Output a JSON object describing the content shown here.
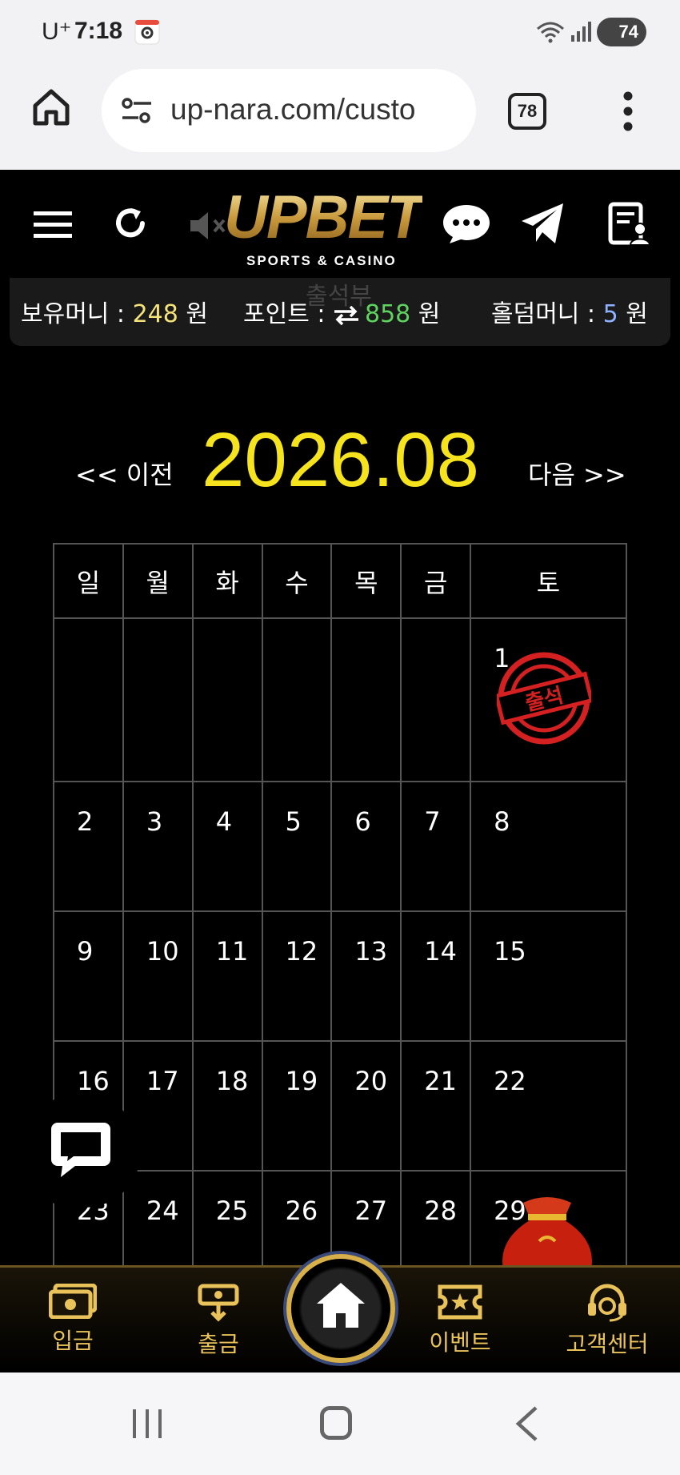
{
  "status_bar": {
    "carrier": "U⁺",
    "time": "7:18",
    "battery": "74"
  },
  "browser": {
    "url": "up-nara.com/custo",
    "tab_count": "78"
  },
  "header": {
    "logo_text": "UPBET",
    "logo_sub": "SPORTS & CASINO"
  },
  "balance": {
    "money_label": "보유머니 : ",
    "money_value": "248",
    "money_unit": " 원",
    "point_label": "포인트 : ",
    "point_value": "858",
    "point_unit": " 원",
    "holdem_label": "홀덤머니 : ",
    "holdem_value": "5",
    "holdem_unit": " 원",
    "ghost_text": "출석부"
  },
  "calendar": {
    "prev_label": "<< 이전",
    "next_label": "다음 >>",
    "month_label": "2026.08",
    "weekdays": [
      "일",
      "월",
      "화",
      "수",
      "목",
      "금",
      "토"
    ],
    "weeks": [
      [
        "",
        "",
        "",
        "",
        "",
        "",
        "1"
      ],
      [
        "2",
        "3",
        "4",
        "5",
        "6",
        "7",
        "8"
      ],
      [
        "9",
        "10",
        "11",
        "12",
        "13",
        "14",
        "15"
      ],
      [
        "16",
        "17",
        "18",
        "19",
        "20",
        "21",
        "22"
      ],
      [
        "23",
        "24",
        "25",
        "26",
        "27",
        "28",
        "29"
      ]
    ],
    "stamp_text": "출석"
  },
  "bottom_nav": {
    "deposit": "입금",
    "withdraw": "출금",
    "event": "이벤트",
    "support": "고객센터"
  },
  "colors": {
    "accent_gold": "#e9c35a",
    "month_yellow": "#f5e31d",
    "point_green": "#5fd35f",
    "stamp_red": "#d42020"
  }
}
